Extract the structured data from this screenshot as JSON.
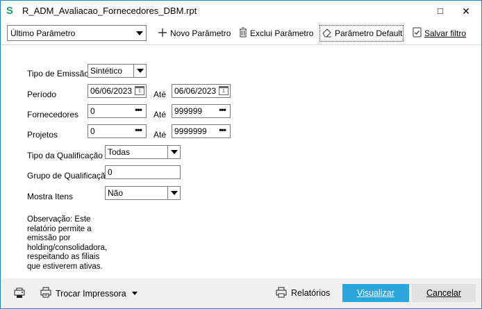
{
  "window": {
    "title": "R_ADM_Avaliacao_Fornecedores_DBM.rpt",
    "maximize_glyph": "□",
    "close_glyph": "✕",
    "app_icon": "S"
  },
  "toolbar": {
    "param_select": "Último Parâmetro",
    "novo_label": "Novo Parâmetro",
    "exclui_label": "Exclui Parâmetro",
    "default_label": "Parâmetro Default",
    "salvar_label": "Salvar filtro",
    "icons": {
      "novo": "plus-icon",
      "exclui": "trash-icon",
      "default": "eraser-icon",
      "salvar": "save-filter-icon"
    }
  },
  "form": {
    "tipo_emissao_label": "Tipo de Emissão",
    "tipo_emissao_value": "Sintético",
    "periodo_label": "Período",
    "periodo_de": "06/06/2023",
    "ate_label": "Até",
    "periodo_ate": "06/06/2023",
    "fornecedores_label": "Fornecedores",
    "fornecedores_de": "0",
    "fornecedores_ate": "999999",
    "projetos_label": "Projetos",
    "projetos_de": "0",
    "projetos_ate": "9999999",
    "tipo_qualificacao_label": "Tipo da Qualificação",
    "tipo_qualificacao_value": "Todas",
    "grupo_qualificacao_label": "Grupo de Qualificação",
    "grupo_qualificacao_value": "0",
    "mostra_itens_label": "Mostra Itens",
    "mostra_itens_value": "Não",
    "ellipsis": "•••",
    "calendar_day": "1",
    "observacao": "Observação: Este relatório permite a emissão por holding/consolidadora, respeitando as filiais que estiverem ativas."
  },
  "footer": {
    "trocar_label": "Trocar Impressora",
    "relatorios_label": "Relatórios",
    "visualizar_label": "Visualizar",
    "cancelar_label": "Cancelar",
    "accent_color": "#2ba5db"
  }
}
